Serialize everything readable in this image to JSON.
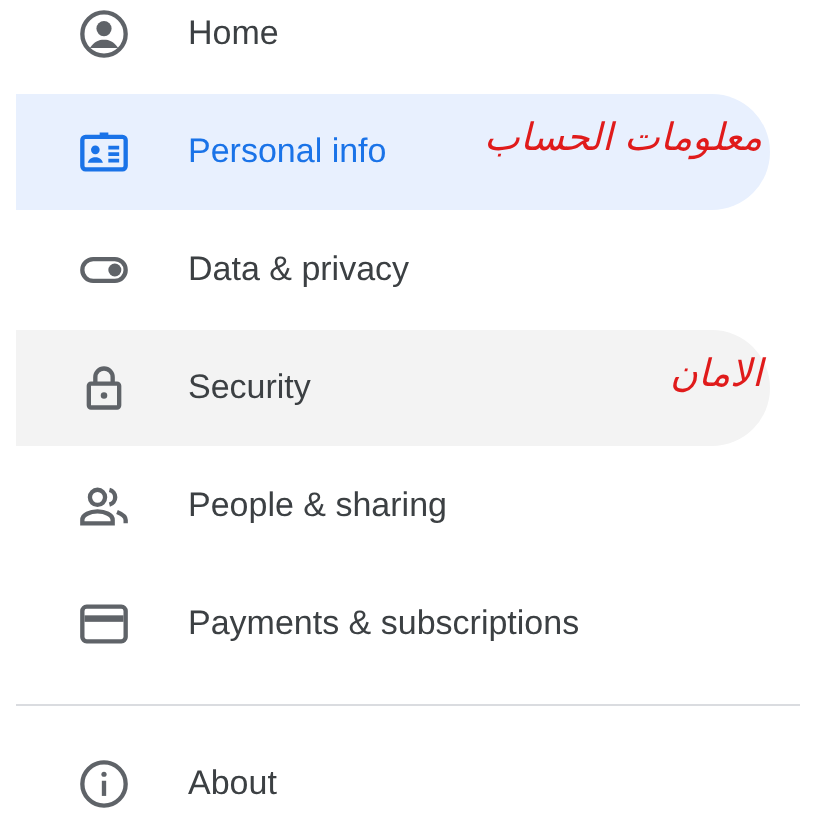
{
  "nav_items": [
    {
      "label": "Home",
      "selected": false,
      "hovered": false
    },
    {
      "label": "Personal info",
      "selected": true,
      "hovered": false,
      "annotation": "معلومات الحساب"
    },
    {
      "label": "Data & privacy",
      "selected": false,
      "hovered": false
    },
    {
      "label": "Security",
      "selected": false,
      "hovered": true,
      "annotation": "الامان"
    },
    {
      "label": "People & sharing",
      "selected": false,
      "hovered": false
    },
    {
      "label": "Payments & subscriptions",
      "selected": false,
      "hovered": false
    }
  ],
  "footer_items": [
    {
      "label": "About",
      "selected": false,
      "hovered": false
    }
  ]
}
